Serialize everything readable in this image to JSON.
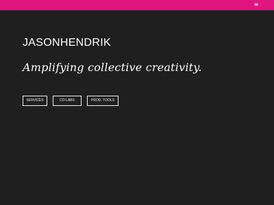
{
  "header": {
    "menu_icon": "hamburger-menu-icon",
    "menu_glyph": "≡"
  },
  "hero": {
    "title": "JASONHENDRIK",
    "tagline": "Amplifying collective creativity."
  },
  "nav": {
    "items": [
      {
        "label": "SERVICES"
      },
      {
        "label": "CO-LABS"
      },
      {
        "label": "PROD. TOOLS"
      }
    ]
  },
  "colors": {
    "accent": "#e0157f",
    "background": "#1f1f1f",
    "text": "#ffffff"
  }
}
